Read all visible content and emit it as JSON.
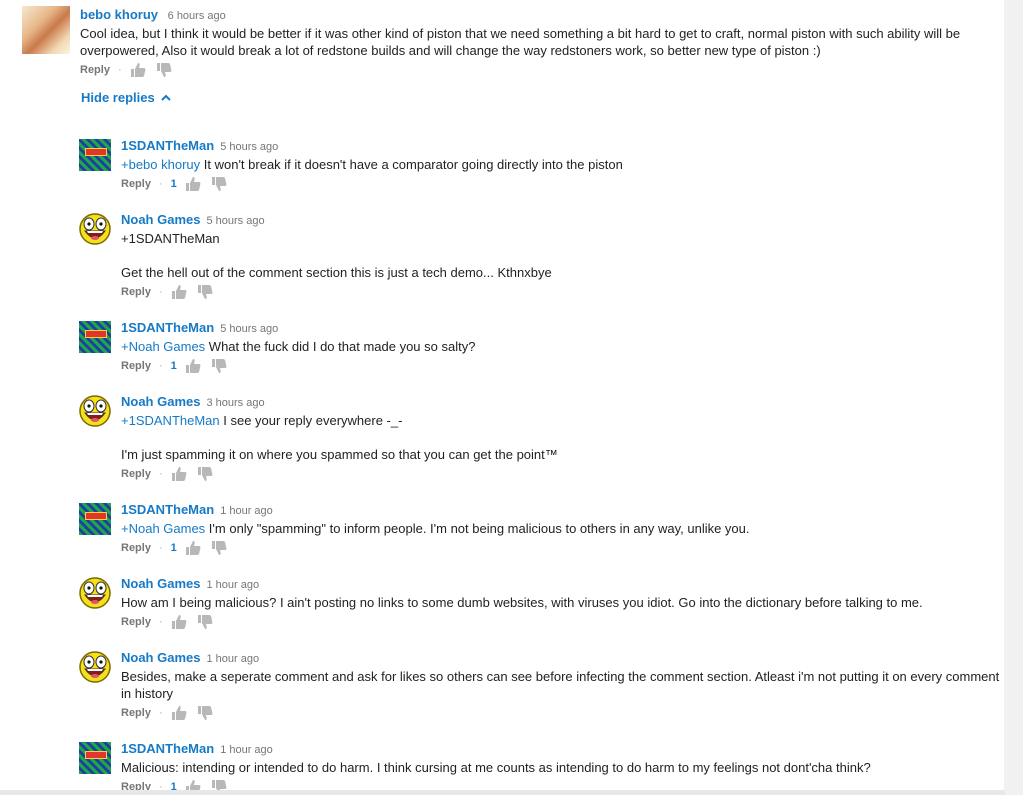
{
  "ui": {
    "reply_label": "Reply",
    "hide_replies_label": "Hide replies"
  },
  "top_comment": {
    "author": "bebo khoruy",
    "time": "6 hours ago",
    "text": "Cool idea, but I  think it would be better if it was other kind of piston that we need something a bit hard to get to craft, normal piston with such ability will be overpowered, Also it would break a lot of redstone builds and will change the way redstoners work, so better new type of piston :)"
  },
  "replies": [
    {
      "author": "1SDANTheMan",
      "avatar": "sdan",
      "time": "5 hours ago",
      "mention": "+bebo khoruy",
      "text": " It won't break if it doesn't have a comparator going directly into the piston",
      "extra": "",
      "likes": "1"
    },
    {
      "author": "Noah Games",
      "avatar": "noah",
      "time": "5 hours ago",
      "mention": "",
      "text": "+1SDANTheMan",
      "extra": "Get the hell out of the comment section this is just a tech demo... Kthnxbye",
      "likes": ""
    },
    {
      "author": "1SDANTheMan",
      "avatar": "sdan",
      "time": "5 hours ago",
      "mention": "+Noah Games",
      "text": " What the fuck did I do that made you so salty?",
      "extra": "",
      "likes": "1"
    },
    {
      "author": "Noah Games",
      "avatar": "noah",
      "time": "3 hours ago",
      "mention": "+1SDANTheMan",
      "text": " I see your reply everywhere -_-",
      "extra": "I'm just spamming it on where you spammed so that you can get the point™",
      "likes": ""
    },
    {
      "author": "1SDANTheMan",
      "avatar": "sdan",
      "time": "1 hour ago",
      "mention": "+Noah Games",
      "text": " I'm only \"spamming\" to inform people. I'm not being malicious to others in any way, unlike you.",
      "extra": "",
      "likes": "1"
    },
    {
      "author": "Noah Games",
      "avatar": "noah",
      "time": "1 hour ago",
      "mention": "",
      "text": "How am I being malicious? I ain't posting no links to some dumb websites, with viruses you idiot. Go into the dictionary before talking to me.",
      "extra": "",
      "likes": ""
    },
    {
      "author": "Noah Games",
      "avatar": "noah",
      "time": "1 hour ago",
      "mention": "",
      "text": "Besides, make a seperate comment and ask for likes so others can see before infecting the comment section. Atleast i'm not putting it on every comment in history",
      "extra": "",
      "likes": ""
    },
    {
      "author": "1SDANTheMan",
      "avatar": "sdan",
      "time": "1 hour ago",
      "mention": "",
      "text": "Malicious: intending or intended to do harm. I think cursing at me counts as intending to do harm to my feelings not dont'cha think?",
      "extra": "",
      "likes": "1"
    }
  ]
}
